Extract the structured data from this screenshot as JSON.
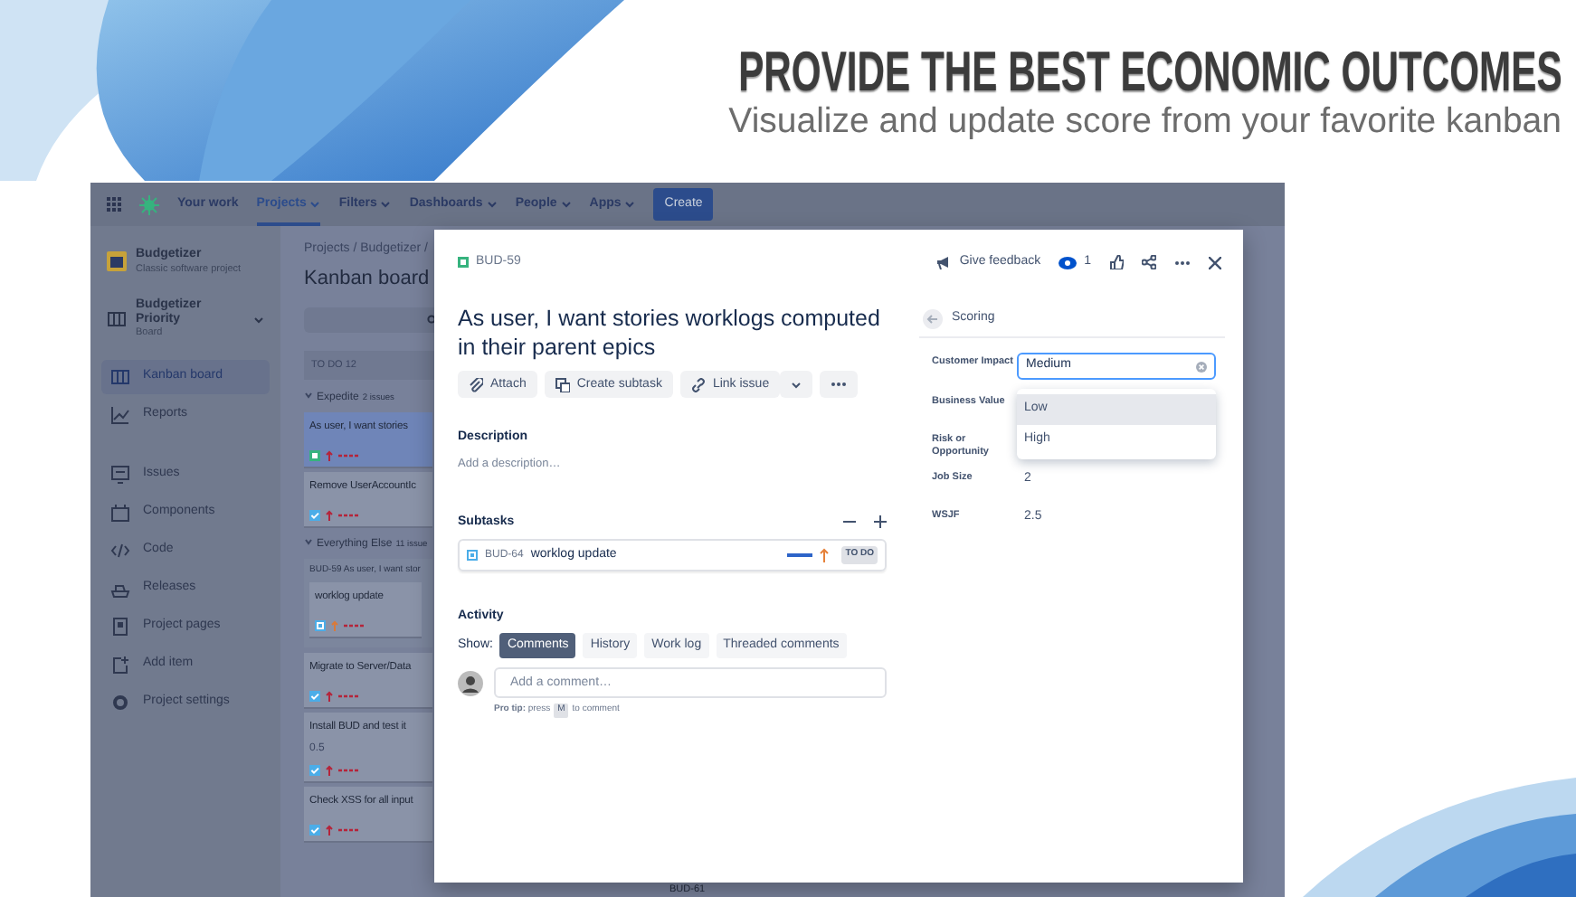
{
  "banner": {
    "headline": "PROVIDE THE BEST ECONOMIC OUTCOMES",
    "subtitle": "Visualize and update score from your favorite kanban"
  },
  "top_nav": {
    "items": [
      {
        "label": "Your work",
        "dropdown": false,
        "selected": false
      },
      {
        "label": "Projects",
        "dropdown": true,
        "selected": true
      },
      {
        "label": "Filters",
        "dropdown": true,
        "selected": false
      },
      {
        "label": "Dashboards",
        "dropdown": true,
        "selected": false
      },
      {
        "label": "People",
        "dropdown": true,
        "selected": false
      },
      {
        "label": "Apps",
        "dropdown": true,
        "selected": false
      }
    ],
    "create_button": "Create"
  },
  "sidebar": {
    "project": {
      "name": "Budgetizer",
      "type": "Classic software project"
    },
    "board": {
      "name": "Budgetizer Priority",
      "type": "Board"
    },
    "items": [
      {
        "label": "Kanban board",
        "kind": "board",
        "selected": true
      },
      {
        "label": "Reports",
        "kind": "reports",
        "selected": false
      },
      {
        "label": "Issues",
        "kind": "issues",
        "selected": false
      },
      {
        "label": "Components",
        "kind": "components",
        "selected": false
      },
      {
        "label": "Code",
        "kind": "code",
        "selected": false
      },
      {
        "label": "Releases",
        "kind": "releases",
        "selected": false
      },
      {
        "label": "Project pages",
        "kind": "pages",
        "selected": false
      },
      {
        "label": "Add item",
        "kind": "add",
        "selected": false
      },
      {
        "label": "Project settings",
        "kind": "settings",
        "selected": false
      }
    ]
  },
  "board": {
    "breadcrumb": "Projects / Budgetizer /",
    "title": "Kanban board",
    "column": {
      "name": "TO DO",
      "count": "12"
    },
    "swimlanes": [
      {
        "name": "Expedite",
        "count": "2 issues",
        "cards": [
          {
            "kind": "story",
            "title": "As user, I want stories",
            "selected": true
          },
          {
            "kind": "task",
            "title": "Remove UserAccountIc",
            "selected": false
          }
        ]
      },
      {
        "name": "Everything Else",
        "count": "11 issue",
        "cards": [
          {
            "kind": "parent",
            "key": "BUD-59",
            "summary": "As user, I want stor",
            "subtask": "worklog update",
            "selected": false
          },
          {
            "kind": "task",
            "title": "Migrate to Server/Data",
            "selected": false
          },
          {
            "kind": "task",
            "title": "Install BUD and test it",
            "estimate": "0.5",
            "selected": false
          },
          {
            "kind": "task",
            "title": "Check XSS for all input",
            "selected": false
          }
        ]
      }
    ],
    "footer_key": "BUD-61"
  },
  "issue_modal": {
    "key": "BUD-59",
    "title": "As user, I want stories worklogs computed in their parent epics",
    "feedback": "Give feedback",
    "watchers": "1",
    "actions": [
      {
        "label": "Attach",
        "kind": "attach"
      },
      {
        "label": "Create subtask",
        "kind": "subtask"
      },
      {
        "label": "Link issue",
        "kind": "link"
      }
    ],
    "description": {
      "heading": "Description",
      "placeholder": "Add a description…"
    },
    "subtasks": {
      "heading": "Subtasks",
      "items": [
        {
          "key": "BUD-64",
          "summary": "worklog update",
          "status": "TO DO"
        }
      ]
    },
    "activity": {
      "heading": "Activity",
      "show_label": "Show:",
      "tabs": [
        {
          "label": "Comments",
          "selected": true
        },
        {
          "label": "History",
          "selected": false
        },
        {
          "label": "Work log",
          "selected": false
        },
        {
          "label": "Threaded comments",
          "selected": false
        }
      ],
      "comment_placeholder": "Add a comment…",
      "pro_tip": "**Pro tip:** press",
      "pro_tip_key": "M",
      "pro_tip_end": "to comment"
    },
    "scoring": {
      "title": "Scoring",
      "fields": [
        {
          "label": "Customer Impact",
          "kind": "select",
          "value": "Medium"
        },
        {
          "label": "Business Value",
          "kind": "text"
        },
        {
          "label": "Risk or Opportunity",
          "kind": "text"
        },
        {
          "label": "Job Size",
          "kind": "text",
          "value": "2"
        },
        {
          "label": "WSJF",
          "kind": "text",
          "value": "2.5"
        }
      ],
      "options": [
        {
          "label": "Low",
          "selected": true
        },
        {
          "label": "High",
          "selected": false
        }
      ]
    }
  }
}
